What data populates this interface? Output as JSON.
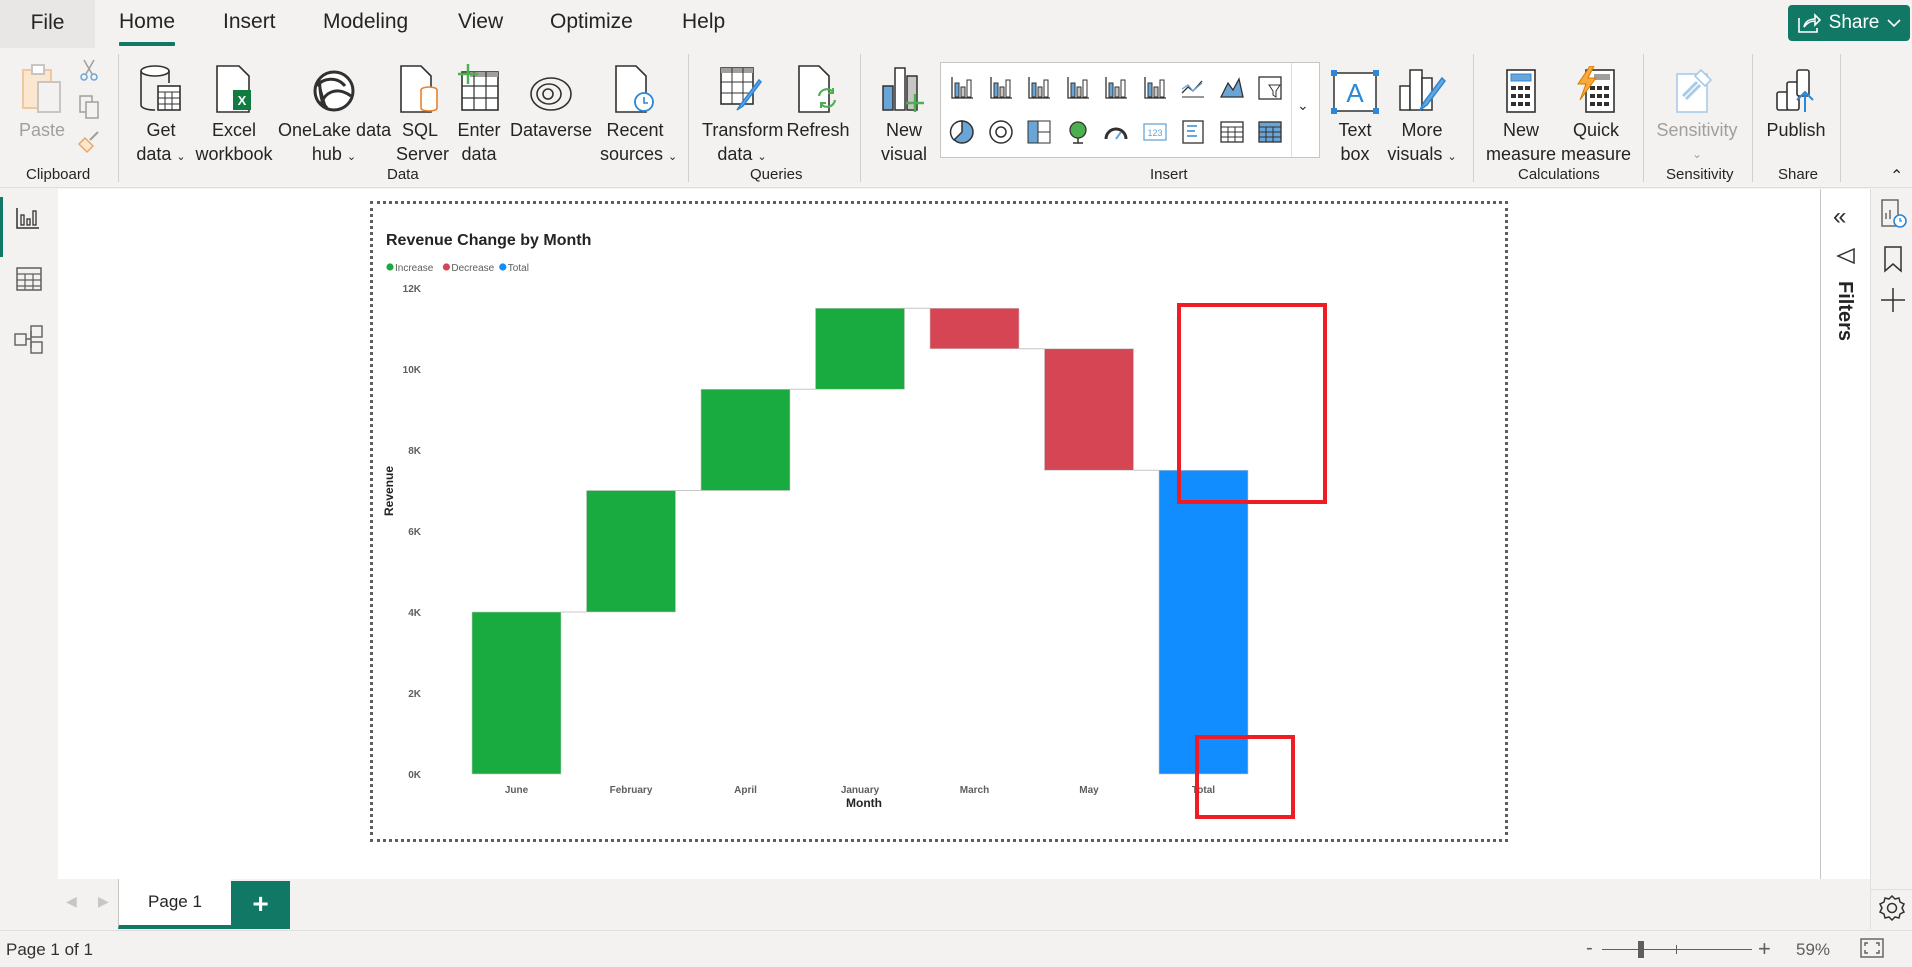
{
  "tabs": {
    "file": "File",
    "items": [
      {
        "label": "Home",
        "active": true
      },
      {
        "label": "Insert"
      },
      {
        "label": "Modeling"
      },
      {
        "label": "View"
      },
      {
        "label": "Optimize"
      },
      {
        "label": "Help"
      }
    ],
    "share_label": "Share"
  },
  "ribbon": {
    "clipboard": {
      "paste": "Paste",
      "group": "Clipboard"
    },
    "data": {
      "get_data_1": "Get",
      "get_data_2": "data",
      "excel_1": "Excel",
      "excel_2": "workbook",
      "onelake_1": "OneLake data",
      "onelake_2": "hub",
      "sql_1": "SQL",
      "sql_2": "Server",
      "enter_1": "Enter",
      "enter_2": "data",
      "dataverse": "Dataverse",
      "recent_1": "Recent",
      "recent_2": "sources",
      "group": "Data"
    },
    "queries": {
      "transform_1": "Transform",
      "transform_2": "data",
      "refresh": "Refresh",
      "group": "Queries"
    },
    "insert": {
      "new_visual_1": "New",
      "new_visual_2": "visual",
      "text_box_1": "Text",
      "text_box_2": "box",
      "more_visuals_1": "More",
      "more_visuals_2": "visuals",
      "group": "Insert",
      "gallery": [
        "stacked-bar",
        "stacked-column",
        "clustered-bar",
        "clustered-column",
        "line-stacked-column",
        "line-clustered-column",
        "line-chart",
        "area-chart",
        "funnel",
        "pie-chart",
        "donut-chart",
        "treemap",
        "map",
        "gauge",
        "card",
        "multi-row-card",
        "table",
        "matrix"
      ]
    },
    "calculations": {
      "new_measure_1": "New",
      "new_measure_2": "measure",
      "quick_measure_1": "Quick",
      "quick_measure_2": "measure",
      "group": "Calculations"
    },
    "sensitivity": {
      "label": "Sensitivity",
      "group": "Sensitivity"
    },
    "share": {
      "publish": "Publish",
      "group": "Share"
    }
  },
  "filters_label": "Filters",
  "pages": {
    "tabs": [
      {
        "label": "Page 1",
        "active": true
      }
    ],
    "add": "+"
  },
  "status": {
    "page_info": "Page 1 of 1",
    "zoom": "59%",
    "zoom_minus": "-",
    "zoom_plus": "+",
    "zoom_value": 59
  },
  "chart_data": {
    "type": "waterfall",
    "title": "Revenue Change by Month",
    "xlabel": "Month",
    "ylabel": "Revenue",
    "categories": [
      "June",
      "February",
      "April",
      "January",
      "March",
      "May",
      "Total"
    ],
    "deltas": [
      4000,
      3000,
      2500,
      2000,
      -1000,
      -3000,
      null
    ],
    "totals": [
      null,
      null,
      null,
      null,
      null,
      null,
      7500
    ],
    "series_kind": [
      "Increase",
      "Increase",
      "Increase",
      "Increase",
      "Decrease",
      "Decrease",
      "Total"
    ],
    "legend": [
      {
        "name": "Increase",
        "color": "#1aab40"
      },
      {
        "name": "Decrease",
        "color": "#d64554"
      },
      {
        "name": "Total",
        "color": "#118dff"
      }
    ],
    "legend_position": "top-left",
    "yticks": [
      0,
      2000,
      4000,
      6000,
      8000,
      10000,
      12000
    ],
    "ytick_labels": [
      "0K",
      "2K",
      "4K",
      "6K",
      "8K",
      "10K",
      "12K"
    ],
    "ylim": [
      0,
      12000
    ],
    "grid": false,
    "highlighted_category": "May"
  }
}
